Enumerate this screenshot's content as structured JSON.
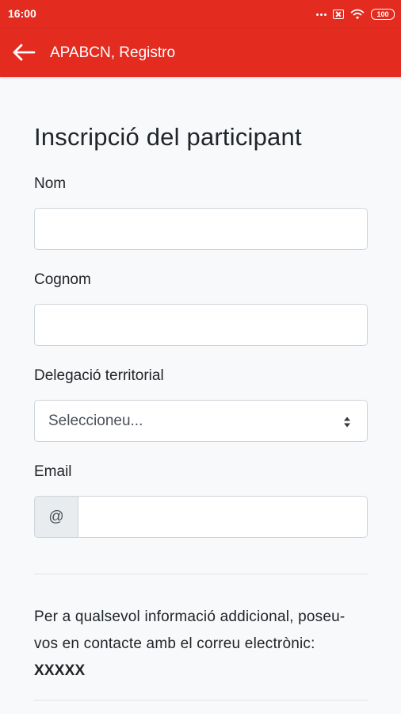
{
  "status_bar": {
    "time": "16:00",
    "battery": "100",
    "icons": [
      "more-dots-icon",
      "sim-off-icon",
      "wifi-icon",
      "battery-icon"
    ],
    "color": "#e42b20"
  },
  "app_bar": {
    "title": "APABCN, Registro",
    "back_icon": "arrow-left-icon",
    "color": "#e42b20"
  },
  "form": {
    "title": "Inscripció del participant",
    "nom_label": "Nom",
    "nom_value": "",
    "cognom_label": "Cognom",
    "cognom_value": "",
    "delegacio_label": "Delegació territorial",
    "delegacio_selected": "Seleccioneu...",
    "email_label": "Email",
    "email_prefix": "@",
    "email_value": ""
  },
  "info": {
    "text": "Per a qualsevol informació addicional, poseu-vos en contacte amb el correu electrònic: ",
    "email": "XXXXX"
  }
}
